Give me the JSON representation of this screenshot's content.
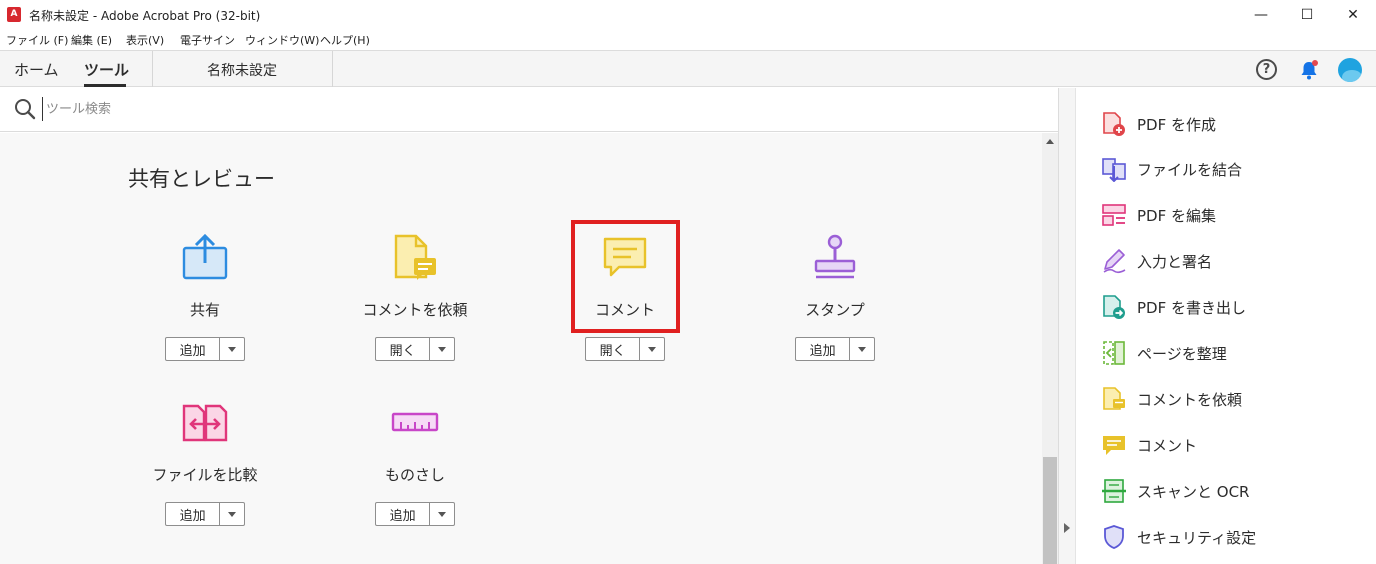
{
  "window": {
    "title": "名称未設定 - Adobe Acrobat Pro (32-bit)",
    "minimize": "—",
    "maximize": "☐",
    "close": "✕"
  },
  "menu": [
    "ファイル (F)",
    "編集 (E)",
    "表示(V)",
    "電子サイン",
    "ウィンドウ(W)",
    "ヘルプ(H)"
  ],
  "tabs": {
    "home": "ホーム",
    "tools": "ツール",
    "document": "名称未設定"
  },
  "header_icons": {
    "help": "?"
  },
  "search": {
    "placeholder": "ツール検索"
  },
  "section": {
    "title": "共有とレビュー"
  },
  "tools": [
    {
      "label": "共有",
      "button": "追加",
      "icon": "share-icon",
      "color": "#2d8ce0"
    },
    {
      "label": "コメントを依頼",
      "button": "開く",
      "icon": "request-comments-icon",
      "color": "#e8c22a"
    },
    {
      "label": "コメント",
      "button": "開く",
      "icon": "comment-icon",
      "color": "#e8c22a"
    },
    {
      "label": "スタンプ",
      "button": "追加",
      "icon": "stamp-icon",
      "color": "#9b5fd6"
    },
    {
      "label": "ファイルを比較",
      "button": "追加",
      "icon": "compare-files-icon",
      "color": "#e0357a"
    },
    {
      "label": "ものさし",
      "button": "追加",
      "icon": "measure-icon",
      "color": "#c846c8"
    }
  ],
  "right_panel": [
    {
      "label": "PDF を作成",
      "icon": "create-pdf-icon",
      "color": "#e0454a"
    },
    {
      "label": "ファイルを結合",
      "icon": "combine-files-icon",
      "color": "#5b59d6"
    },
    {
      "label": "PDF を編集",
      "icon": "edit-pdf-icon",
      "color": "#e0357a"
    },
    {
      "label": "入力と署名",
      "icon": "fill-sign-icon",
      "color": "#9b5fd6"
    },
    {
      "label": "PDF を書き出し",
      "icon": "export-pdf-icon",
      "color": "#1f9e8e"
    },
    {
      "label": "ページを整理",
      "icon": "organize-pages-icon",
      "color": "#6cb83a"
    },
    {
      "label": "コメントを依頼",
      "icon": "request-comments-icon",
      "color": "#e8c22a"
    },
    {
      "label": "コメント",
      "icon": "comment-icon",
      "color": "#e8c22a"
    },
    {
      "label": "スキャンと OCR",
      "icon": "scan-ocr-icon",
      "color": "#2fa83f"
    },
    {
      "label": "セキュリティ設定",
      "icon": "security-shield-icon",
      "color": "#5b59d6"
    }
  ],
  "colors": {
    "highlight": "#e02020"
  }
}
